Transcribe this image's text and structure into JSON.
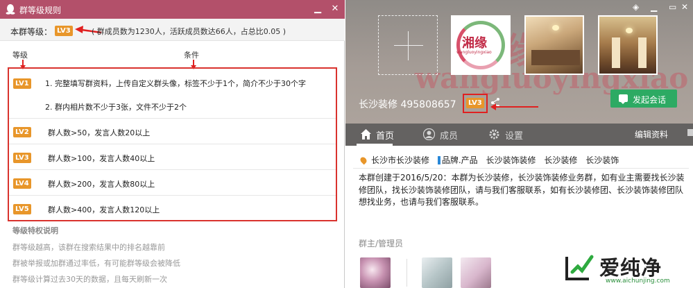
{
  "left_window": {
    "title": "群等级规则",
    "current_level_label": "本群等级：",
    "current_level": "LV3",
    "stats": "( 群成员数为1230人，活跃成员数达66人，占总比0.05 )",
    "header_level": "等级",
    "header_condition": "条件",
    "rules": [
      {
        "level": "LV1",
        "conditions": [
          "1. 完整填写群资料，上传自定义群头像，标签不少于1个，简介不少于30个字",
          "2. 群内相片数不少于3张，文件不少于2个"
        ]
      },
      {
        "level": "LV2",
        "conditions": [
          "群人数>50，发言人数20以上"
        ]
      },
      {
        "level": "LV3",
        "conditions": [
          "群人数>100，发言人数40以上"
        ]
      },
      {
        "level": "LV4",
        "conditions": [
          "群人数>200，发言人数80以上"
        ]
      },
      {
        "level": "LV5",
        "conditions": [
          "群人数>400，发言人数120以上"
        ]
      }
    ],
    "privilege_title": "等级特权说明",
    "privilege_lines": [
      "群等级越高，该群在搜索结果中的排名越靠前",
      "群被举报或加群通过率低，有可能群等级会被降低",
      "群等级计算过去30天的数据，且每天刷新一次"
    ],
    "icons": {
      "app": "qq-penguin-icon",
      "minimize": "minimize-icon",
      "close": "close-icon"
    }
  },
  "right_window": {
    "group_name": "长沙装修 495808657",
    "level_badge": "LV3",
    "chat_button": "发起会话",
    "tabs": [
      {
        "label": "首页",
        "icon": "home-icon"
      },
      {
        "label": "成员",
        "icon": "member-icon"
      },
      {
        "label": "设置",
        "icon": "gear-icon"
      }
    ],
    "edit_profile": "编辑资料",
    "location": "长沙市长沙装修",
    "category": "品牌.产品",
    "tags": [
      "长沙装饰装修",
      "长沙装修",
      "长沙装饰"
    ],
    "intro": "本群创建于2016/5/20：本群为长沙装修，长沙装饰装修业务群，如有业主需要找长沙装修团队，找长沙装饰装修团队，请与我们客服联系，如有长沙装修团、长沙装饰装修团队想找业务，也请与我们客服联系。",
    "admin_title": "群主/管理员",
    "logo_text": "湘缘",
    "logo_sub": "wangluoyingxiao",
    "banner_text": "wangluoyingxiao",
    "icons": {
      "skin": "skin-icon",
      "close": "close-icon",
      "share": "share-icon",
      "chat": "chat-icon",
      "add_photo": "add-photo-icon",
      "location": "location-pin-icon"
    }
  },
  "watermark": {
    "name": "爱纯净",
    "url": "www.aichunjing.com"
  },
  "colors": {
    "titlebar": "#b3506a",
    "badge": "#e8962a",
    "highlight": "#d9322d",
    "chat_button": "#2daa63"
  }
}
